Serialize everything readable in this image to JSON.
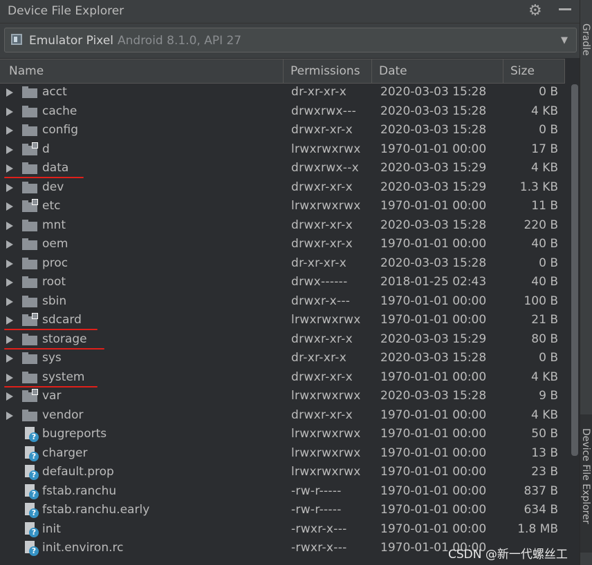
{
  "window": {
    "title": "Device File Explorer"
  },
  "device": {
    "name": "Emulator Pixel",
    "info": "Android 8.1.0, API 27"
  },
  "side_strip": {
    "top_label": "Gradle",
    "bottom_label": "Device File Explorer"
  },
  "columns": {
    "name": "Name",
    "permissions": "Permissions",
    "date": "Date",
    "size": "Size"
  },
  "files": [
    {
      "name": "acct",
      "permissions": "dr-xr-xr-x",
      "date": "2020-03-03 15:28",
      "size": "0 B",
      "type": "folder"
    },
    {
      "name": "cache",
      "permissions": "drwxrwx---",
      "date": "2020-03-03 15:28",
      "size": "4 KB",
      "type": "folder"
    },
    {
      "name": "config",
      "permissions": "drwxr-xr-x",
      "date": "2020-03-03 15:28",
      "size": "0 B",
      "type": "folder"
    },
    {
      "name": "d",
      "permissions": "lrwxrwxrwx",
      "date": "1970-01-01 00:00",
      "size": "17 B",
      "type": "link"
    },
    {
      "name": "data",
      "permissions": "drwxrwx--x",
      "date": "2020-03-03 15:29",
      "size": "4 KB",
      "type": "folder"
    },
    {
      "name": "dev",
      "permissions": "drwxr-xr-x",
      "date": "2020-03-03 15:29",
      "size": "1.3 KB",
      "type": "folder"
    },
    {
      "name": "etc",
      "permissions": "lrwxrwxrwx",
      "date": "1970-01-01 00:00",
      "size": "11 B",
      "type": "link"
    },
    {
      "name": "mnt",
      "permissions": "drwxr-xr-x",
      "date": "2020-03-03 15:28",
      "size": "220 B",
      "type": "folder"
    },
    {
      "name": "oem",
      "permissions": "drwxr-xr-x",
      "date": "1970-01-01 00:00",
      "size": "40 B",
      "type": "folder"
    },
    {
      "name": "proc",
      "permissions": "dr-xr-xr-x",
      "date": "2020-03-03 15:28",
      "size": "0 B",
      "type": "folder"
    },
    {
      "name": "root",
      "permissions": "drwx------",
      "date": "2018-01-25 02:43",
      "size": "40 B",
      "type": "folder"
    },
    {
      "name": "sbin",
      "permissions": "drwxr-x---",
      "date": "1970-01-01 00:00",
      "size": "100 B",
      "type": "folder"
    },
    {
      "name": "sdcard",
      "permissions": "lrwxrwxrwx",
      "date": "1970-01-01 00:00",
      "size": "21 B",
      "type": "link"
    },
    {
      "name": "storage",
      "permissions": "drwxr-xr-x",
      "date": "2020-03-03 15:29",
      "size": "80 B",
      "type": "folder"
    },
    {
      "name": "sys",
      "permissions": "dr-xr-xr-x",
      "date": "2020-03-03 15:28",
      "size": "0 B",
      "type": "folder"
    },
    {
      "name": "system",
      "permissions": "drwxr-xr-x",
      "date": "1970-01-01 00:00",
      "size": "4 KB",
      "type": "folder"
    },
    {
      "name": "var",
      "permissions": "lrwxrwxrwx",
      "date": "2020-03-03 15:28",
      "size": "9 B",
      "type": "link"
    },
    {
      "name": "vendor",
      "permissions": "drwxr-xr-x",
      "date": "1970-01-01 00:00",
      "size": "4 KB",
      "type": "folder"
    },
    {
      "name": "bugreports",
      "permissions": "lrwxrwxrwx",
      "date": "1970-01-01 00:00",
      "size": "50 B",
      "type": "filelink"
    },
    {
      "name": "charger",
      "permissions": "lrwxrwxrwx",
      "date": "1970-01-01 00:00",
      "size": "13 B",
      "type": "filelink"
    },
    {
      "name": "default.prop",
      "permissions": "lrwxrwxrwx",
      "date": "1970-01-01 00:00",
      "size": "23 B",
      "type": "filelink"
    },
    {
      "name": "fstab.ranchu",
      "permissions": "-rw-r-----",
      "date": "1970-01-01 00:00",
      "size": "837 B",
      "type": "file"
    },
    {
      "name": "fstab.ranchu.early",
      "permissions": "-rw-r-----",
      "date": "1970-01-01 00:00",
      "size": "634 B",
      "type": "file"
    },
    {
      "name": "init",
      "permissions": "-rwxr-x---",
      "date": "1970-01-01 00:00",
      "size": "1.8 MB",
      "type": "file"
    },
    {
      "name": "init.environ.rc",
      "permissions": "-rwxr-x---",
      "date": "1970-01-01 00:00",
      "size": "",
      "type": "file"
    }
  ],
  "highlighted": [
    "data",
    "sdcard",
    "storage",
    "system"
  ],
  "colors": {
    "underline": "#e0201a",
    "folder": "#8c9197",
    "file_badge": "#3592c4"
  },
  "watermark": "CSDN @新一代螺丝工"
}
